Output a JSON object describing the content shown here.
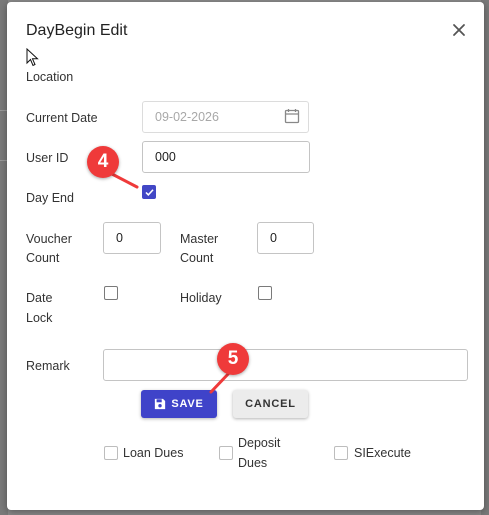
{
  "dialog": {
    "title": "DayBegin Edit",
    "close_icon": "close-icon"
  },
  "form": {
    "location_label": "Location",
    "current_date_label": "Current Date",
    "current_date_value": "09-02-2026",
    "calendar_icon": "calendar-icon",
    "user_id_label": "User ID",
    "user_id_value": "000",
    "day_end_label": "Day End",
    "day_end_checked": true,
    "voucher_count_label_1": "Voucher",
    "voucher_count_label_2": "Count",
    "voucher_count_value": "0",
    "master_count_label_1": "Master",
    "master_count_label_2": "Count",
    "master_count_value": "0",
    "date_lock_label_1": "Date",
    "date_lock_label_2": "Lock",
    "date_lock_checked": false,
    "holiday_label": "Holiday",
    "holiday_checked": false,
    "remark_label": "Remark",
    "remark_value": ""
  },
  "buttons": {
    "save_label": "SAVE",
    "save_icon": "save-icon",
    "cancel_label": "CANCEL"
  },
  "options": {
    "loan_dues_label": "Loan Dues",
    "deposit_dues_label_1": "Deposit",
    "deposit_dues_label_2": "Dues",
    "siexecute_label": "SIExecute"
  },
  "annotations": {
    "step_4": "4",
    "step_5": "5"
  },
  "colors": {
    "accent": "#3f43c9",
    "annotation": "#ef3a3a"
  }
}
